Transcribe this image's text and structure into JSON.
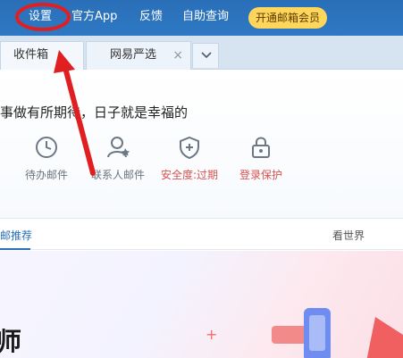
{
  "nav": {
    "settings": "设置",
    "official_app": "官方App",
    "feedback": "反馈",
    "self_help": "自助查询",
    "vip": "开通邮箱会员"
  },
  "tabs": {
    "inbox": "收件箱",
    "yanxuan": "网易严选",
    "close": "×"
  },
  "panel": {
    "greeting": "事做有所期待，日子就是幸福的",
    "quick_actions": [
      {
        "label": "待办邮件",
        "icon": "clock-icon"
      },
      {
        "label": "联系人邮件",
        "icon": "contact-icon"
      },
      {
        "label": "安全度:过期",
        "icon": "shield-icon"
      },
      {
        "label": "登录保护",
        "icon": "lock-icon"
      }
    ]
  },
  "subtabs": {
    "recommend": "邮推荐",
    "world": "看世界"
  },
  "banner": {
    "big_char": "师"
  },
  "colors": {
    "nav_blue": "#2a6fb8",
    "vip_yellow": "#ffd65c",
    "warn_red": "#d9534f",
    "annotation_red": "#e02020"
  }
}
